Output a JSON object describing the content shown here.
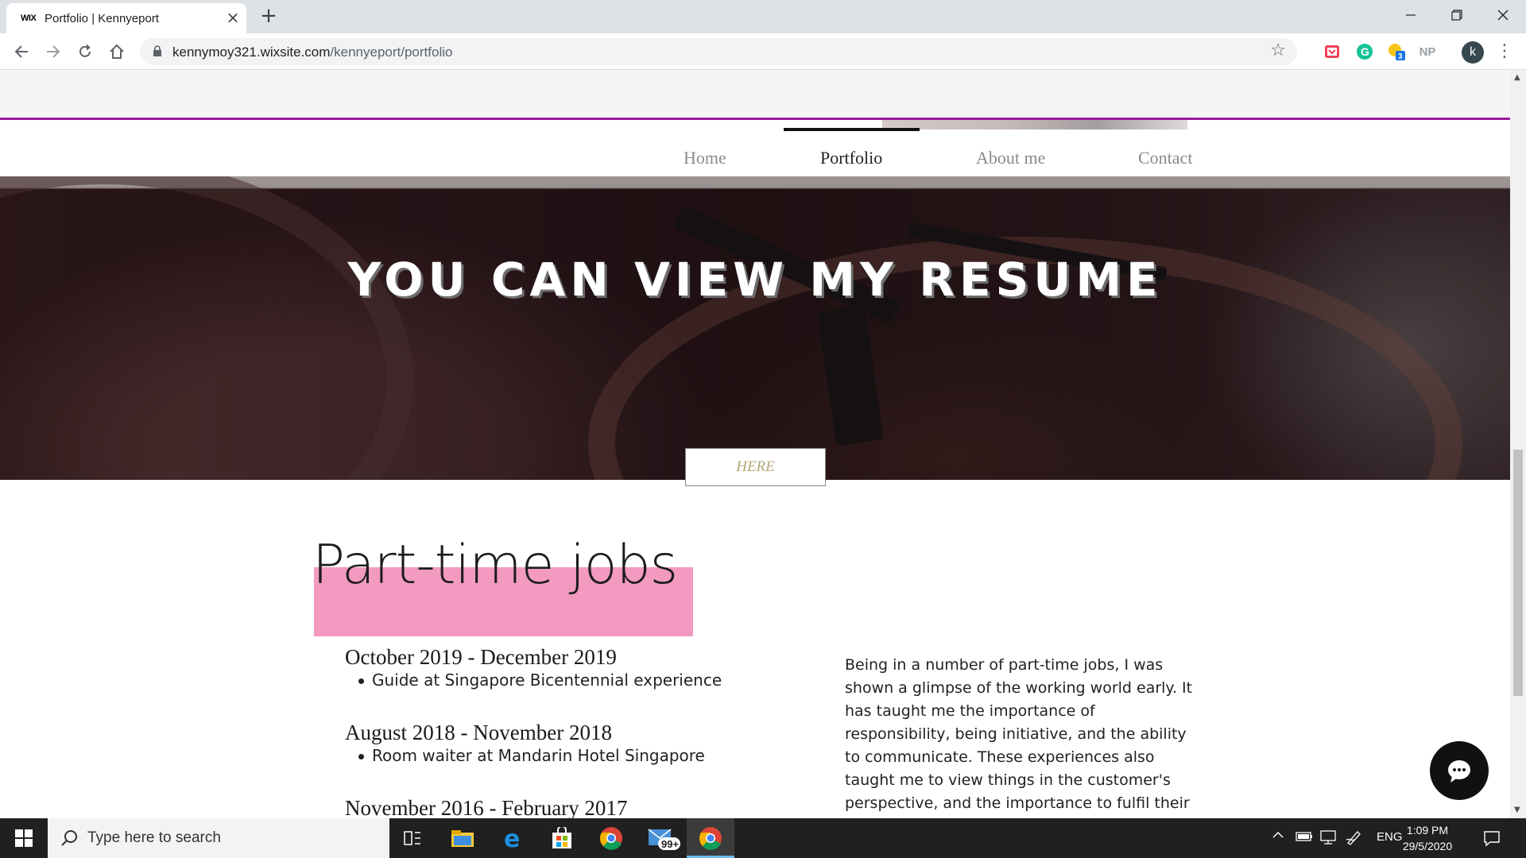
{
  "browser": {
    "tab_title": "Portfolio | Kennyeport",
    "tab_favicon": "WIX",
    "new_tab_label": "+",
    "url_host": "kennymoy321.wixsite.com",
    "url_path": "/kennyeport/portfolio",
    "ext_np": "NP",
    "ext_badge": "3",
    "profile_initial": "k"
  },
  "nav": {
    "items": [
      {
        "label": "Home"
      },
      {
        "label": "Portfolio"
      },
      {
        "label": "About me"
      },
      {
        "label": "Contact"
      }
    ],
    "active": "Portfolio"
  },
  "hero": {
    "title": "YOU CAN VIEW MY RESUME",
    "button_label": "HERE"
  },
  "section": {
    "title": "Part-time jobs",
    "jobs": [
      {
        "date": "October 2019 - December 2019",
        "item": "Guide at Singapore Bicentennial experience"
      },
      {
        "date": "August 2018 - November 2018",
        "item": "Room waiter at Mandarin Hotel Singapore"
      },
      {
        "date": "November 2016 - February 2017"
      }
    ],
    "paragraph": "Being in a number of part-time jobs, I was shown a glimpse of the working world early. It has taught me the importance of responsibility, being initiative, and the ability to communicate. These experiences also taught me to view things in the customer's perspective, and the importance to fulfil their"
  },
  "taskbar": {
    "search_placeholder": "Type here to search",
    "mail_badge": "99+",
    "lang": "ENG",
    "time": "1:09 PM",
    "date": "29/5/2020"
  },
  "colors": {
    "accent_purple": "#9a1a9a",
    "highlight_pink": "#f29ac0",
    "here_text": "#b4a978"
  }
}
